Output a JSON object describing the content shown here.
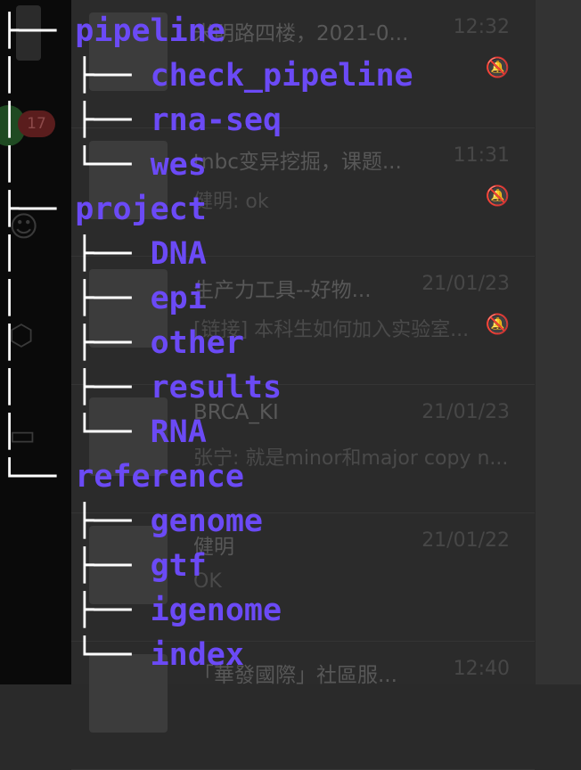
{
  "dock": {
    "unread_count": "17",
    "icons": [
      "avatar-icon",
      "chat-bubble-icon",
      "contacts-icon",
      "box-icon",
      "folder-icon"
    ]
  },
  "chat_list": [
    {
      "name": "米明路四楼，2021-0...",
      "time": "12:32",
      "preview": ""
    },
    {
      "name": "tnbc变异挖掘，课题...",
      "time": "11:31",
      "preview": "健明: ok"
    },
    {
      "name": "生产力工具--好物...",
      "time": "21/01/23",
      "preview": "[链接] 本科生如何加入实验室..."
    },
    {
      "name": "BRCA_KI",
      "time": "21/01/23",
      "preview": "张宁: 就是minor和major copy n..."
    },
    {
      "name": "健明",
      "time": "21/01/22",
      "preview": "OK"
    },
    {
      "name": "「華發國際」社區服...",
      "time": "12:40",
      "preview": ""
    }
  ],
  "tree": [
    {
      "prefix": "├── ",
      "label": "pipeline"
    },
    {
      "prefix": "│   ├── ",
      "label": "check_pipeline"
    },
    {
      "prefix": "│   ├── ",
      "label": "rna-seq"
    },
    {
      "prefix": "│   └── ",
      "label": "wes"
    },
    {
      "prefix": "├── ",
      "label": "project"
    },
    {
      "prefix": "│   ├── ",
      "label": "DNA"
    },
    {
      "prefix": "│   ├── ",
      "label": "epi"
    },
    {
      "prefix": "│   ├── ",
      "label": "other"
    },
    {
      "prefix": "│   ├── ",
      "label": "results"
    },
    {
      "prefix": "│   └── ",
      "label": "RNA"
    },
    {
      "prefix": "└── ",
      "label": "reference"
    },
    {
      "prefix": "    ├── ",
      "label": "genome"
    },
    {
      "prefix": "    ├── ",
      "label": "gtf"
    },
    {
      "prefix": "    ├── ",
      "label": "igenome"
    },
    {
      "prefix": "    └── ",
      "label": "index"
    }
  ]
}
